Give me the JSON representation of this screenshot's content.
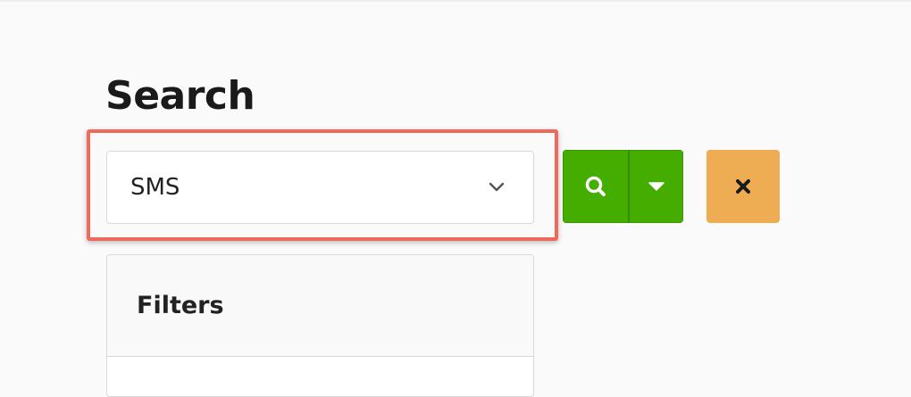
{
  "page": {
    "title": "Search"
  },
  "search": {
    "selected_value": "SMS",
    "search_icon": "search-icon",
    "dropdown_icon": "caret-down-icon",
    "clear_icon": "close-icon"
  },
  "filters": {
    "title": "Filters"
  },
  "colors": {
    "highlight": "#f06a5c",
    "search_button": "#44ad00",
    "clear_button": "#efad53",
    "background": "#fafafa"
  }
}
